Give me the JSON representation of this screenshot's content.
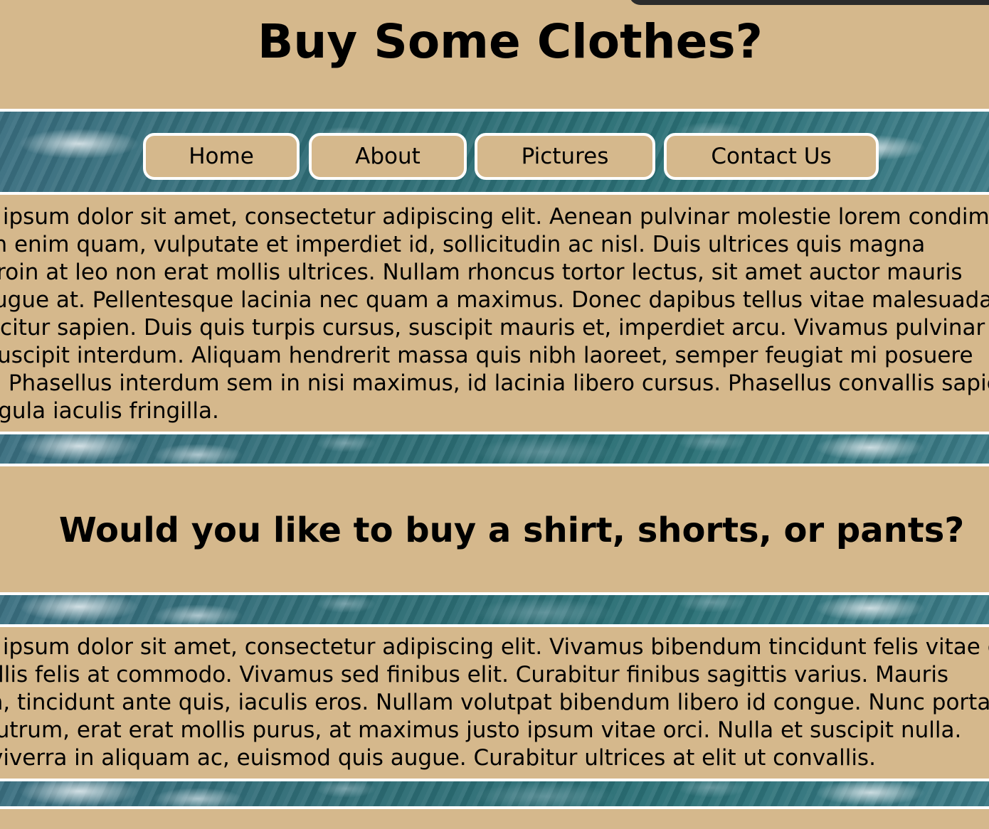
{
  "page": {
    "title": "Buy Some Clothes?",
    "nav": [
      {
        "label": "Home"
      },
      {
        "label": "About"
      },
      {
        "label": "Pictures"
      },
      {
        "label": "Contact Us"
      }
    ],
    "paragraph1": [
      "Lorem ipsum dolor sit amet, consectetur adipiscing elit. Aenean pulvinar molestie lorem condimentum",
      "Aenean enim quam, vulputate et imperdiet id, sollicitudin ac nisl. Duis ultrices quis magna",
      "Proin at leo non erat mollis ultrices. Nullam rhoncus tortor lectus, sit amet auctor mauris",
      "augue at. Pellentesque lacinia nec quam a maximus. Donec dapibus tellus vitae malesuada",
      "efficitur sapien. Duis quis turpis cursus, suscipit mauris et, imperdiet arcu. Vivamus pulvinar",
      "suscipit interdum. Aliquam hendrerit massa quis nibh laoreet, semper feugiat mi posuere",
      "t. Phasellus interdum sem in nisi maximus, id lacinia libero cursus. Phasellus convallis sapien",
      "ligula iaculis fringilla."
    ],
    "subheading": "Would you like to buy a shirt, shorts, or pants?",
    "paragraph2": [
      "Lorem ipsum dolor sit amet, consectetur adipiscing elit. Vivamus bibendum tincidunt felis vitae gravida",
      "mollis felis at commodo. Vivamus sed finibus elit. Curabitur finibus sagittis varius. Mauris",
      "em, tincidunt ante quis, iaculis eros. Nullam volutpat bibendum libero id congue. Nunc porta",
      "rutrum, erat erat mollis purus, at maximus justo ipsum vitae orci. Nulla et suscipit nulla.",
      "s viverra in aliquam ac, euismod quis augue. Curabitur ultrices at elit ut convallis."
    ]
  },
  "colors": {
    "background": "#d5b88c",
    "border": "#ffffff",
    "ocean": "#2f6f78",
    "text": "#000000"
  }
}
